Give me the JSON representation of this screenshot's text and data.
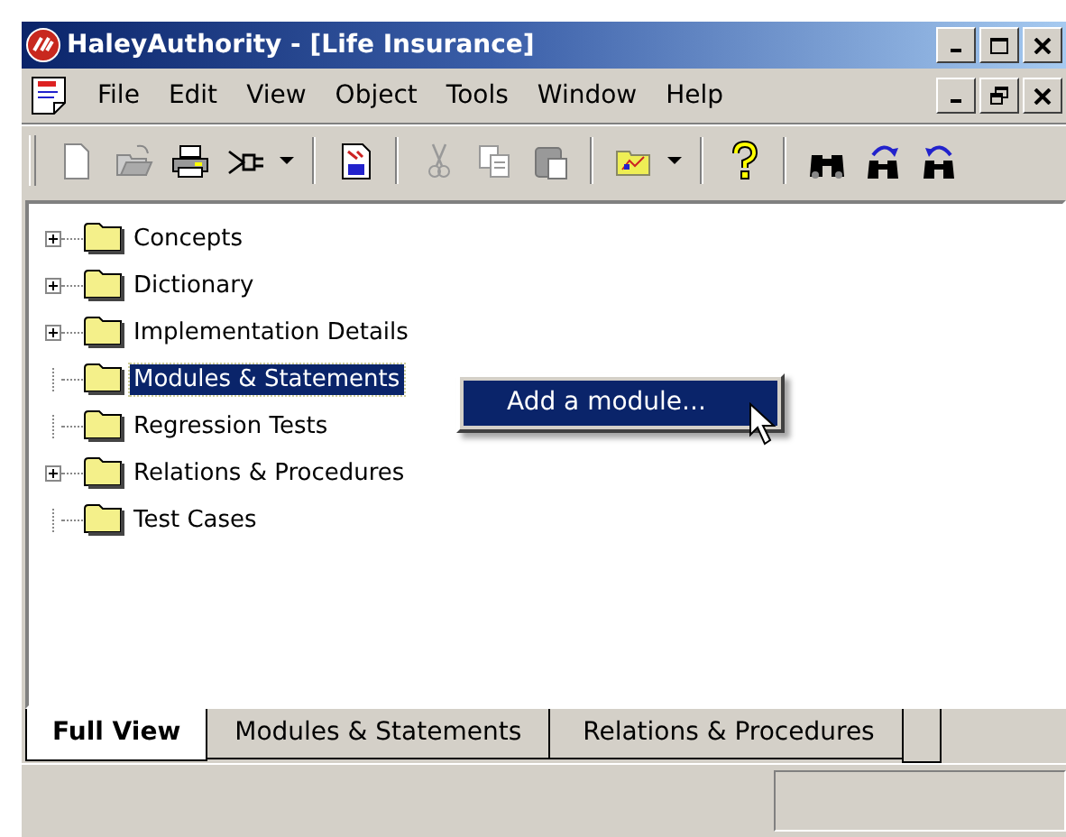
{
  "window": {
    "title": "HaleyAuthority - [Life Insurance]"
  },
  "menu": [
    "File",
    "Edit",
    "View",
    "Object",
    "Tools",
    "Window",
    "Help"
  ],
  "tree": [
    {
      "label": "Concepts",
      "expandable": true,
      "selected": false
    },
    {
      "label": "Dictionary",
      "expandable": true,
      "selected": false
    },
    {
      "label": "Implementation Details",
      "expandable": true,
      "selected": false
    },
    {
      "label": "Modules & Statements",
      "expandable": false,
      "selected": true
    },
    {
      "label": "Regression Tests",
      "expandable": false,
      "selected": false
    },
    {
      "label": "Relations & Procedures",
      "expandable": true,
      "selected": false
    },
    {
      "label": "Test Cases",
      "expandable": false,
      "selected": false
    }
  ],
  "context_menu": [
    {
      "label": "Add a module...",
      "selected": true
    }
  ],
  "tabs": [
    {
      "label": "Full View",
      "selected": true
    },
    {
      "label": "Modules & Statements",
      "selected": false
    },
    {
      "label": "Relations & Procedures",
      "selected": false
    }
  ]
}
